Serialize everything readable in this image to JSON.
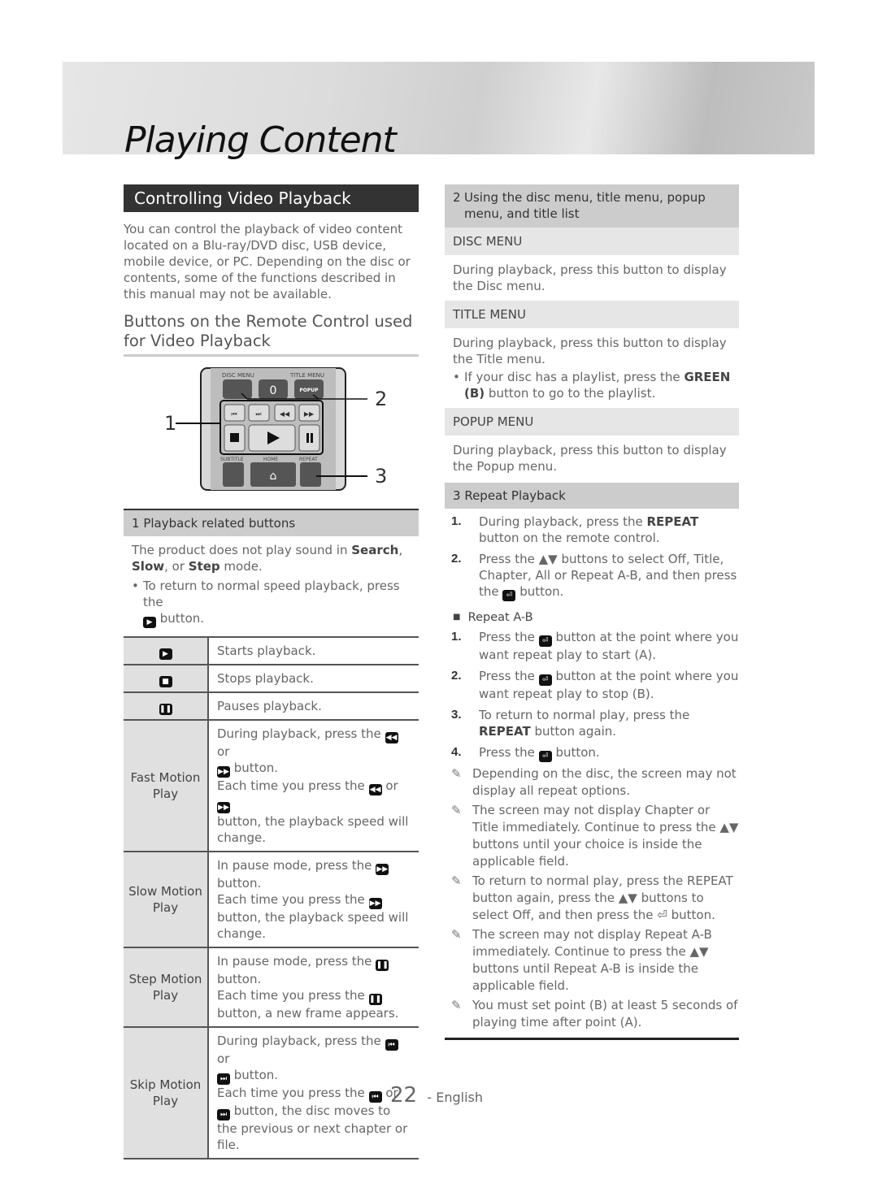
{
  "banner": {
    "title": "Playing Content"
  },
  "left": {
    "section_title": "Controlling Video Playback",
    "intro": "You can control the playback of video content located on a Blu-ray/DVD disc, USB device, mobile device, or PC. Depending on the disc or contents, some of the functions described in this manual may not be available.",
    "subtitle": "Buttons on the Remote Control used for Video Playback",
    "remote": {
      "labels": {
        "disc_menu": "DISC MENU",
        "title_menu": "TITLE MENU",
        "zero": "0",
        "popup": "POPUP",
        "subtitle": "SUBTITLE",
        "home": "HOME",
        "repeat": "REPEAT"
      },
      "callouts": [
        "1",
        "2",
        "3"
      ]
    },
    "playback_header_num": "1",
    "playback_header": "Playback related buttons",
    "playback_note_pre": "The product does not play sound in ",
    "playback_note_search": "Search",
    "playback_note_mid1": ", ",
    "playback_note_slow": "Slow",
    "playback_note_mid2": ", or ",
    "playback_note_step": "Step",
    "playback_note_post": " mode.",
    "bullet_pre": "To return to normal speed playback, press the",
    "bullet_post": "button.",
    "table": {
      "rows": [
        {
          "key_icon": "play-icon",
          "text": "Starts playback."
        },
        {
          "key_icon": "stop-icon",
          "text": "Stops playback."
        },
        {
          "key_icon": "pause-icon",
          "text": "Pauses playback."
        },
        {
          "key": "Fast Motion Play",
          "l1": "During playback, press the",
          "l1b": "or",
          "l2": "button.",
          "l3": "Each time you press the",
          "l3b": "or",
          "l4": "button, the playback speed will change."
        },
        {
          "key": "Slow Motion Play",
          "l1": "In pause mode, press the",
          "l2": "button.",
          "l3": "Each time you press the",
          "l4": "button, the playback speed will change."
        },
        {
          "key": "Step Motion Play",
          "l1": "In pause mode, press the",
          "l2": "button.",
          "l3": "Each time you press the",
          "l4": "button, a new frame appears."
        },
        {
          "key": "Skip Motion Play",
          "l1": "During playback, press the",
          "l1b": "or",
          "l2": "button.",
          "l3": "Each time you press the",
          "l3b": "or",
          "l4": "button, the disc moves to the previous or next chapter or file."
        }
      ]
    }
  },
  "right": {
    "menu_header_num": "2",
    "menu_header": "Using the disc menu, title menu, popup menu, and title list",
    "disc_menu": {
      "title": "DISC MENU",
      "text": "During playback, press this button to display the Disc menu."
    },
    "title_menu": {
      "title": "TITLE MENU",
      "text": "During playback, press this button to display the Title menu.",
      "bullet_pre": "If your disc has a playlist, press the ",
      "bullet_bold": "GREEN (B)",
      "bullet_post": " button to go to the playlist."
    },
    "popup_menu": {
      "title": "POPUP MENU",
      "text": "During playback, press this button to display the Popup menu."
    },
    "repeat_header_num": "3",
    "repeat_header": "Repeat Playback",
    "steps": [
      {
        "n": "1.",
        "pre": "During playback, press the ",
        "b": "REPEAT",
        "post": " button on the remote control."
      },
      {
        "n": "2.",
        "text": "Press the ▲▼ buttons to select Off, Title, Chapter, All or Repeat A-B, and then press the",
        "post": "button."
      }
    ],
    "ab_title": "Repeat A-B",
    "ab_steps": [
      {
        "n": "1.",
        "pre": "Press the",
        "post": "button at the point where you want repeat play to start (A)."
      },
      {
        "n": "2.",
        "pre": "Press the",
        "post": "button at the point where you want repeat play to stop (B)."
      },
      {
        "n": "3.",
        "pre": "To return to normal play, press the ",
        "b": "REPEAT",
        "post": " button again."
      },
      {
        "n": "4.",
        "pre": "Press the",
        "post": "button."
      }
    ],
    "notes": [
      "Depending on the disc, the screen may not display all repeat options.",
      "The screen may not display Chapter or Title immediately. Continue to press the ▲▼ buttons until your choice is inside the applicable field.",
      "To return to normal play, press the REPEAT button again, press the ▲▼ buttons to select Off, and then press the ⏎ button.",
      "The screen may not display Repeat A-B immediately. Continue to press the ▲▼ buttons until Repeat A-B is inside the applicable field.",
      "You must set point (B) at least 5 seconds of playing time after point (A)."
    ]
  },
  "footer": {
    "page": "22",
    "lang": "- English"
  }
}
